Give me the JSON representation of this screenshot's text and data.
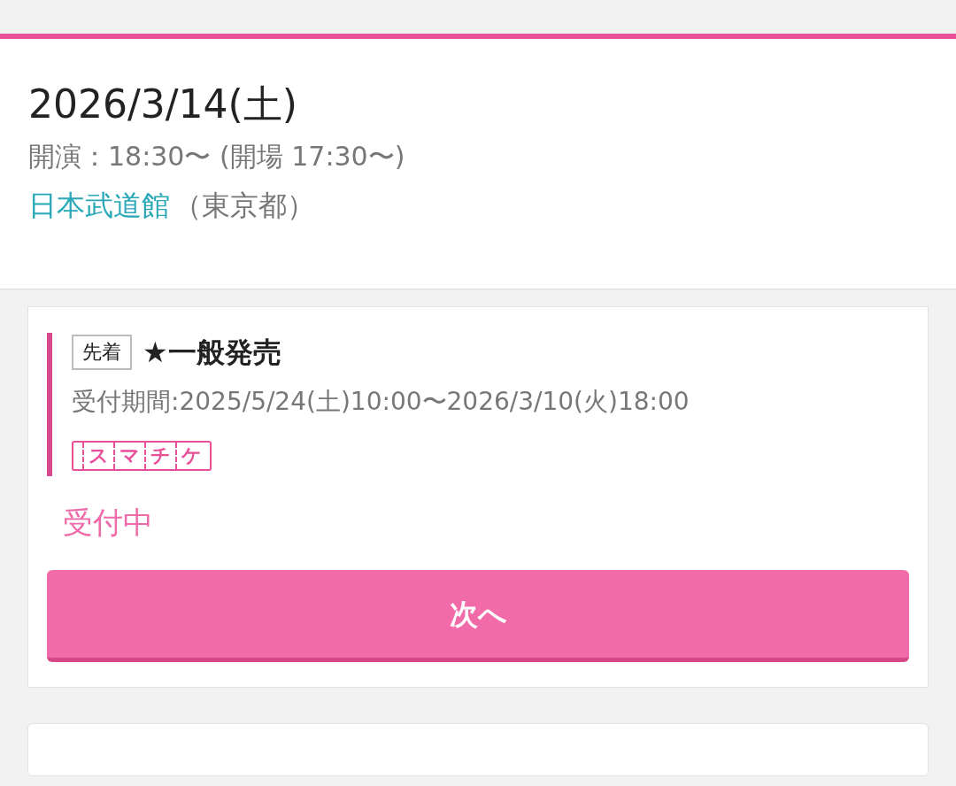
{
  "event": {
    "date": "2026/3/14(土)",
    "time": "開演：18:30〜 (開場 17:30〜)",
    "venue": "日本武道館",
    "prefecture": "（東京都）"
  },
  "sale": {
    "badge": "先着",
    "title": "★一般発売",
    "period": "受付期間:2025/5/24(土)10:00〜2026/3/10(火)18:00",
    "ticket_logo": "スマチケ",
    "status": "受付中",
    "button": "次へ"
  }
}
